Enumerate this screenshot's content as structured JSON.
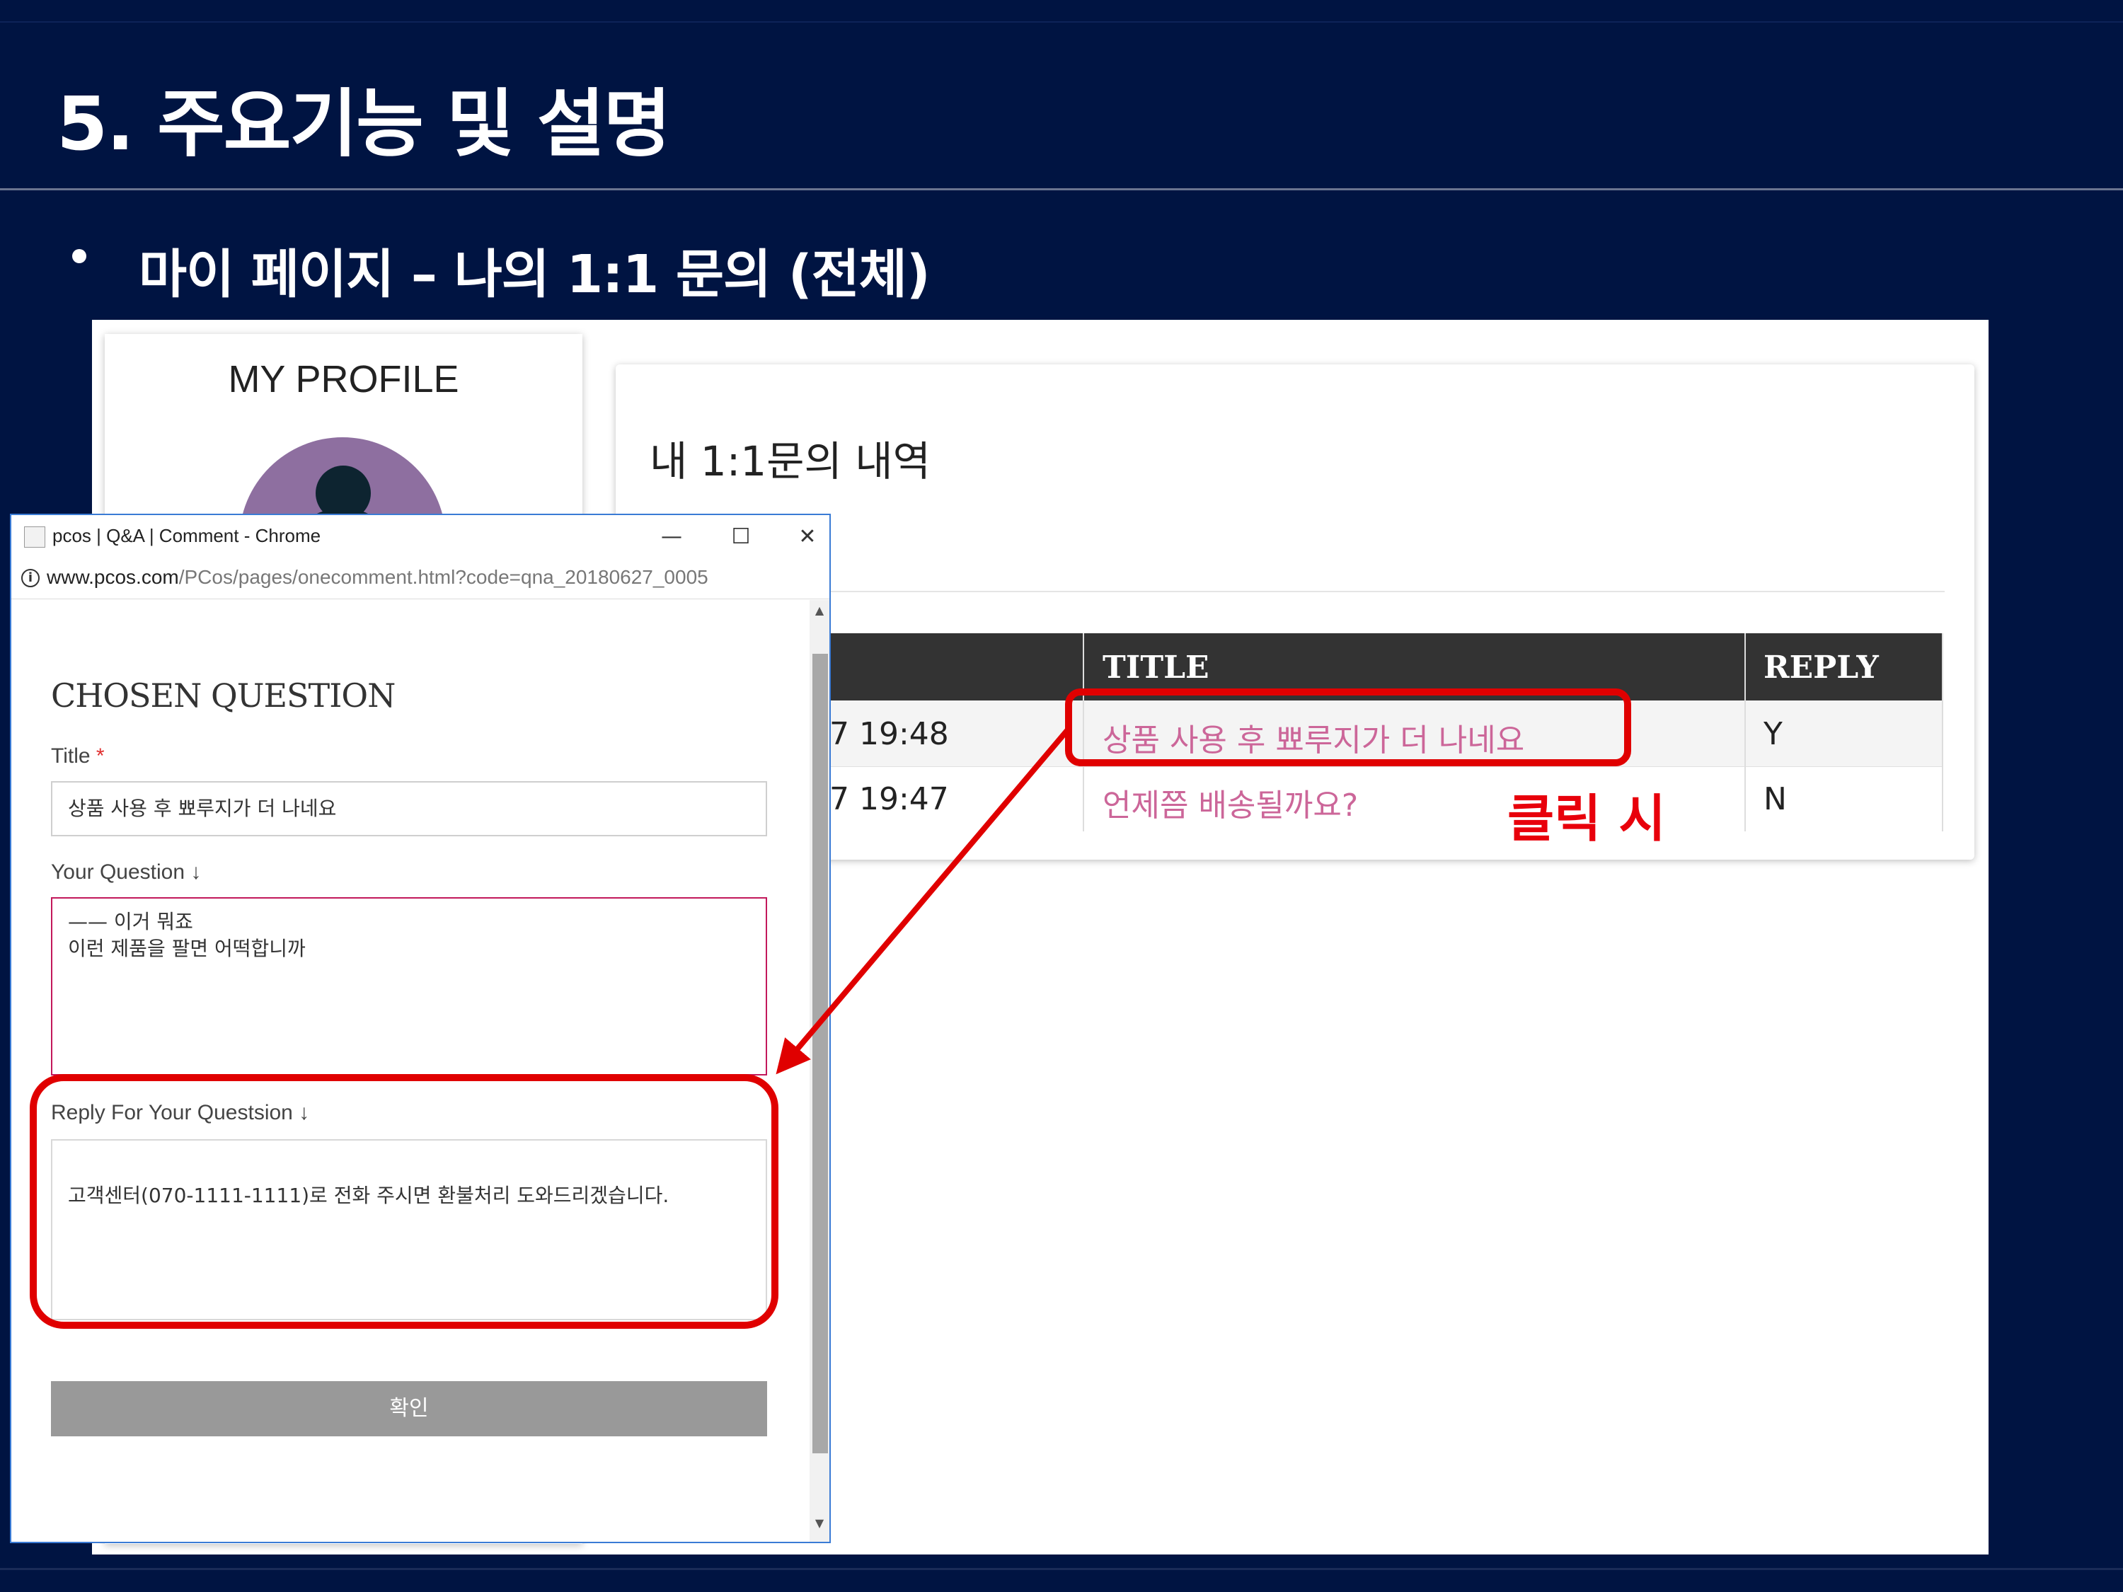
{
  "slide": {
    "title": "5. 주요기능 및 설명",
    "subtitle": "마이 페이지 – 나의 1:1 문의 (전체)"
  },
  "profile": {
    "title": "MY PROFILE"
  },
  "qna_list": {
    "title": "내 1:1문의 내역",
    "columns": [
      "TITLE",
      "REPLY"
    ],
    "rows": [
      {
        "date": "7 19:48",
        "title": "상품 사용 후 뾰루지가 더 나네요",
        "reply": "Y"
      },
      {
        "date": "7 19:47",
        "title": "언제쯤 배송될까요?",
        "reply": "N"
      }
    ]
  },
  "annotation": {
    "click_label": "클릭 시",
    "color": "#e00000"
  },
  "popup": {
    "window_title": "pcos | Q&A | Comment - Chrome",
    "url_host": "www.pcos.com",
    "url_path": "/PCos/pages/onecomment.html?code=qna_20180627_0005",
    "heading": "CHOSEN QUESTION",
    "title_label": "Title",
    "required_mark": "*",
    "title_value": "상품 사용 후 뾰루지가 더 나네요",
    "question_label": "Your Question ↓",
    "question_lines": [
      "—— 이거 뭐죠",
      "이런 제품을 팔면 어떡합니까"
    ],
    "reply_label": "Reply For Your Questsion ↓",
    "reply_value": "고객센터(070-1111-1111)로 전화 주시면 환불처리 도와드리겠습니다.",
    "confirm_label": "확인",
    "icons": {
      "minimize": "—",
      "maximize": "☐",
      "close": "✕",
      "info": "i",
      "scroll_up": "▲",
      "scroll_down": "▼"
    }
  },
  "colors": {
    "slide_background": "#001442",
    "table_header": "#333333",
    "link": "#cc6699",
    "highlight": "#e00000"
  }
}
